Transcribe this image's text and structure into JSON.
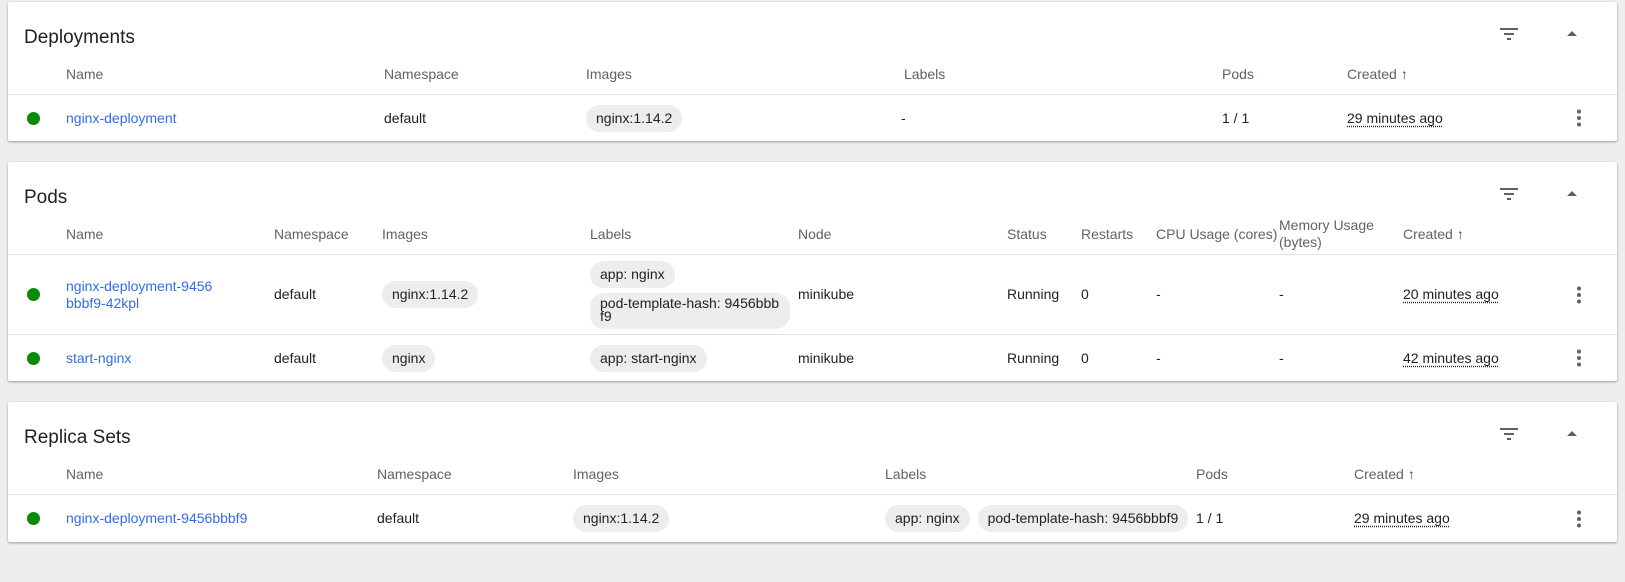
{
  "deployments": {
    "title": "Deployments",
    "columns": {
      "name": "Name",
      "namespace": "Namespace",
      "images": "Images",
      "labels": "Labels",
      "pods": "Pods",
      "created": "Created"
    },
    "rows": [
      {
        "name": "nginx-deployment",
        "namespace": "default",
        "image": "nginx:1.14.2",
        "labels": "-",
        "pods": "1 / 1",
        "created": "29 minutes ago"
      }
    ]
  },
  "pods": {
    "title": "Pods",
    "columns": {
      "name": "Name",
      "namespace": "Namespace",
      "images": "Images",
      "labels": "Labels",
      "node": "Node",
      "status": "Status",
      "restarts": "Restarts",
      "cpu": "CPU Usage (cores)",
      "memory": "Memory Usage (bytes)",
      "created": "Created"
    },
    "rows": [
      {
        "name": "nginx-deployment-9456bbbf9-42kpl",
        "namespace": "default",
        "image": "nginx:1.14.2",
        "labels": [
          "app: nginx",
          "pod-template-hash: 9456bbbf9"
        ],
        "node": "minikube",
        "status": "Running",
        "restarts": "0",
        "cpu": "-",
        "memory": "-",
        "created": "20 minutes ago"
      },
      {
        "name": "start-nginx",
        "namespace": "default",
        "image": "nginx",
        "labels": [
          "app: start-nginx"
        ],
        "node": "minikube",
        "status": "Running",
        "restarts": "0",
        "cpu": "-",
        "memory": "-",
        "created": "42 minutes ago"
      }
    ]
  },
  "replica_sets": {
    "title": "Replica Sets",
    "columns": {
      "name": "Name",
      "namespace": "Namespace",
      "images": "Images",
      "labels": "Labels",
      "pods": "Pods",
      "created": "Created"
    },
    "rows": [
      {
        "name": "nginx-deployment-9456bbbf9",
        "namespace": "default",
        "image": "nginx:1.14.2",
        "labels": [
          "app: nginx",
          "pod-template-hash: 9456bbbf9"
        ],
        "pods": "1 / 1",
        "created": "29 minutes ago"
      }
    ]
  },
  "sort_indicator": "↑",
  "colors": {
    "status_ok": "#0a8a0a",
    "link": "#326de6",
    "chip_bg": "#ededed"
  },
  "icons": {
    "filter": "filter-icon",
    "collapse": "chevron-up-icon",
    "menu": "more-vert-icon"
  }
}
